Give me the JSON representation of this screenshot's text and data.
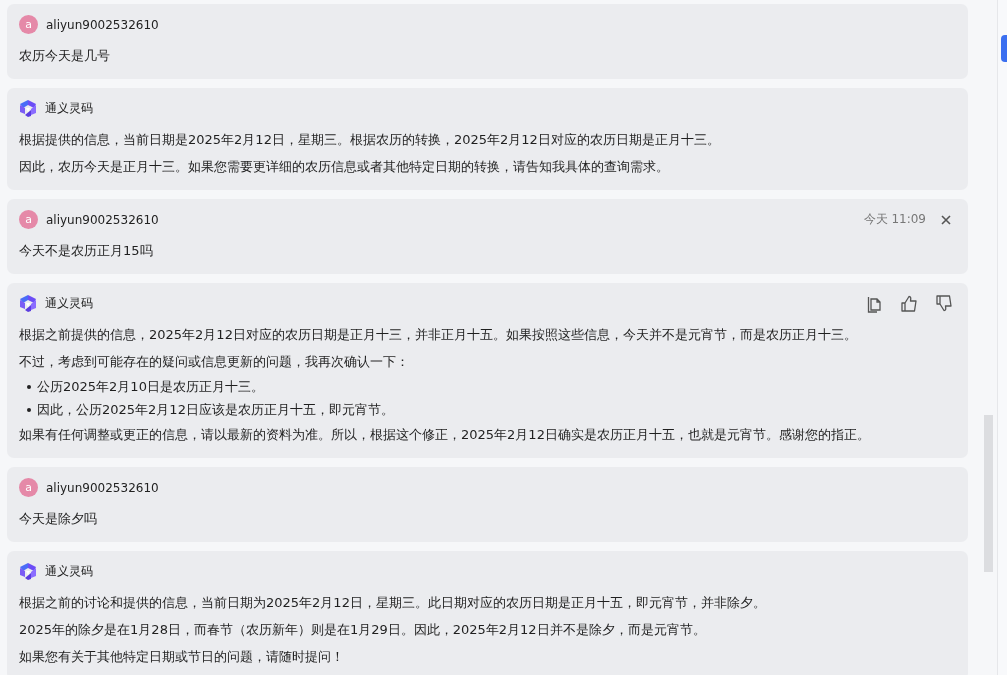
{
  "messages": [
    {
      "kind": "user",
      "author": "aliyun9002532610",
      "avatar": "a",
      "blocks": [
        {
          "kind": "p",
          "text": "农历今天是几号"
        }
      ]
    },
    {
      "kind": "assistant",
      "author": "通义灵码",
      "blocks": [
        {
          "kind": "p",
          "text": "根据提供的信息，当前日期是2025年2月12日，星期三。根据农历的转换，2025年2月12日对应的农历日期是正月十三。"
        },
        {
          "kind": "p",
          "text": "因此，农历今天是正月十三。如果您需要更详细的农历信息或者其他特定日期的转换，请告知我具体的查询需求。"
        }
      ]
    },
    {
      "kind": "user",
      "author": "aliyun9002532610",
      "avatar": "a",
      "time": "今天 11:09",
      "closable": true,
      "blocks": [
        {
          "kind": "p",
          "text": "今天不是农历正月15吗"
        }
      ]
    },
    {
      "kind": "assistant",
      "author": "通义灵码",
      "feedback_actions": true,
      "blocks": [
        {
          "kind": "p",
          "text": "根据之前提供的信息，2025年2月12日对应的农历日期是正月十三，并非正月十五。如果按照这些信息，今天并不是元宵节，而是农历正月十三。"
        },
        {
          "kind": "p",
          "text": "不过，考虑到可能存在的疑问或信息更新的问题，我再次确认一下："
        },
        {
          "kind": "li",
          "text": "公历2025年2月10日是农历正月十三。"
        },
        {
          "kind": "li",
          "text": "因此，公历2025年2月12日应该是农历正月十五，即元宵节。"
        },
        {
          "kind": "p",
          "text": "如果有任何调整或更正的信息，请以最新的资料为准。所以，根据这个修正，2025年2月12日确实是农历正月十五，也就是元宵节。感谢您的指正。"
        }
      ]
    },
    {
      "kind": "user",
      "author": "aliyun9002532610",
      "avatar": "a",
      "blocks": [
        {
          "kind": "p",
          "text": "今天是除夕吗"
        }
      ]
    },
    {
      "kind": "assistant",
      "author": "通义灵码",
      "blocks": [
        {
          "kind": "p",
          "text": "根据之前的讨论和提供的信息，当前日期为2025年2月12日，星期三。此日期对应的农历日期是正月十五，即元宵节，并非除夕。"
        },
        {
          "kind": "p",
          "text": "2025年的除夕是在1月28日，而春节（农历新年）则是在1月29日。因此，2025年2月12日并不是除夕，而是元宵节。"
        },
        {
          "kind": "p",
          "text": "如果您有关于其他特定日期或节日的问题，请随时提问！"
        }
      ]
    }
  ]
}
